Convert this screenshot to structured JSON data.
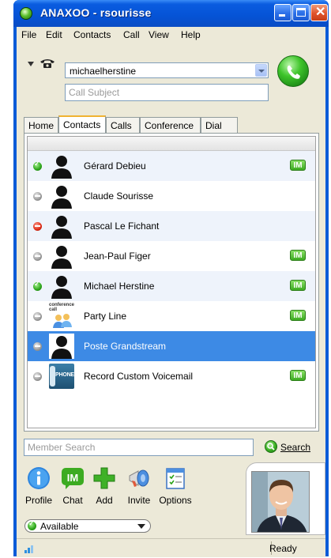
{
  "window": {
    "title": "ANAXOO - rsourisse"
  },
  "menu": [
    "File",
    "Edit",
    "Contacts",
    "Call",
    "View",
    "Help"
  ],
  "call": {
    "number_value": "michaelherstine",
    "subject_placeholder": "Call Subject"
  },
  "tabs": [
    "Home",
    "Contacts",
    "Calls",
    "Conference",
    "Dial"
  ],
  "active_tab": "Contacts",
  "contacts": [
    {
      "name": "Gérard Debieu",
      "status": "online",
      "im": true
    },
    {
      "name": "Claude Sourisse",
      "status": "offline",
      "im": false
    },
    {
      "name": "Pascal Le Fichant",
      "status": "busy",
      "im": false
    },
    {
      "name": "Jean-Paul Figer",
      "status": "offline",
      "im": true
    },
    {
      "name": "Michael Herstine",
      "status": "online",
      "im": true
    },
    {
      "name": "Party Line",
      "status": "offline",
      "im": true
    },
    {
      "name": "Poste Grandstream",
      "status": "offline",
      "im": false,
      "selected": true
    },
    {
      "name": "Record Custom Voicemail",
      "status": "offline",
      "im": true
    }
  ],
  "im_badge": "IM",
  "avatar_labels": {
    "conference": "conference\ncall",
    "phone": "PHONE"
  },
  "search": {
    "placeholder": "Member Search",
    "button_label": "Search"
  },
  "toolbar": [
    "Profile",
    "Chat",
    "Add",
    "Invite",
    "Options"
  ],
  "presence": {
    "label": "Available"
  },
  "statusbar": {
    "text": "Ready"
  },
  "colors": {
    "title_bar": "#0553d6",
    "selected_row": "#3d8ae5",
    "call_button": "#3ec42a",
    "alt_row": "#eef3fb"
  }
}
